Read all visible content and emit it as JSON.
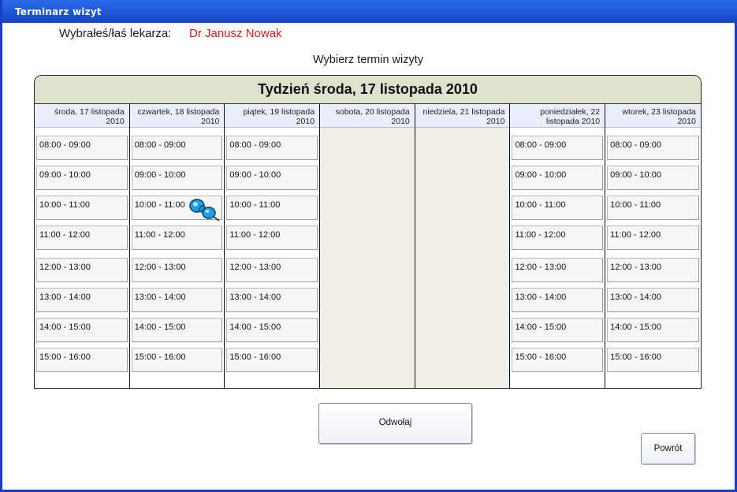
{
  "window": {
    "title": "Terminarz wizyt"
  },
  "doctor": {
    "label": "Wybrałeś/łaś lekarza:",
    "name": "Dr Janusz Nowak"
  },
  "subtitle": "Wybierz termin wizyty",
  "calendar": {
    "week_title": "Tydzień środa, 17 listopada 2010",
    "days": [
      {
        "label": "środa, 17 listopada 2010",
        "available": true
      },
      {
        "label": "czwartek, 18 listopada 2010",
        "available": true
      },
      {
        "label": "piątek, 19 listopada 2010",
        "available": true
      },
      {
        "label": "sobota, 20 listopada 2010",
        "available": false
      },
      {
        "label": "niedziela, 21 listopada 2010",
        "available": false
      },
      {
        "label": "poniedziałek, 22 listopada 2010",
        "available": true
      },
      {
        "label": "wtorek, 23 listopada 2010",
        "available": true
      }
    ],
    "slots": [
      "08:00 - 09:00",
      "09:00 - 10:00",
      "10:00 - 11:00",
      "11:00 - 12:00",
      "12:00 - 13:00",
      "13:00 - 14:00",
      "14:00 - 15:00",
      "15:00 - 16:00"
    ],
    "selected": {
      "day": "czwartek, 18 listopada 2010",
      "slot": "10:00 - 11:00",
      "marker_icon": "pushpin-icon"
    }
  },
  "buttons": {
    "cancel": "Odwołaj",
    "back": "Powrót"
  },
  "colors": {
    "titlebar": "#1d56d8",
    "doctor_name": "#d21c1c",
    "week_header": "#dde2cf",
    "closed_day": "#efefe6"
  }
}
